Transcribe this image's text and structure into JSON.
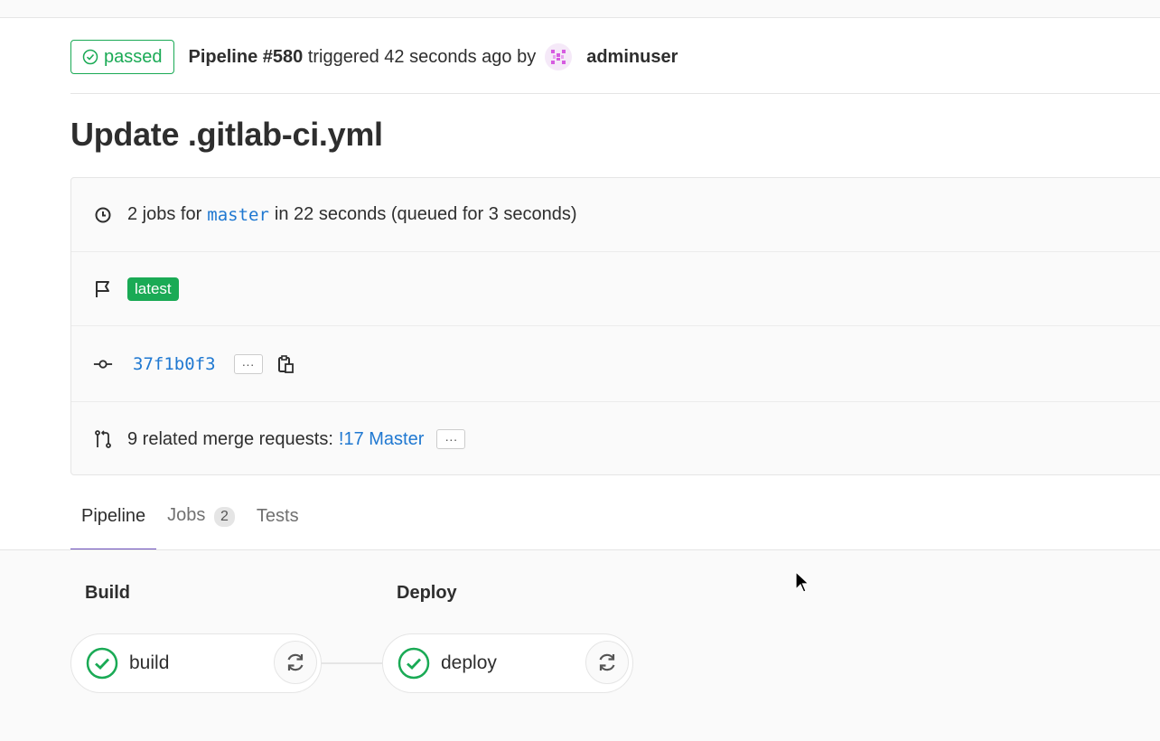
{
  "header": {
    "status_label": "passed",
    "pipeline_label": "Pipeline #580",
    "triggered_text": "triggered 42 seconds ago by",
    "user": "adminuser"
  },
  "title": "Update .gitlab-ci.yml",
  "info": {
    "jobs_prefix": "2 jobs for",
    "branch": "master",
    "jobs_suffix": "in 22 seconds (queued for 3 seconds)",
    "tag": "latest",
    "commit_sha": "37f1b0f3",
    "more_label": "···",
    "mr_prefix": "9 related merge requests:",
    "mr_link": "!17 Master"
  },
  "tabs": [
    {
      "label": "Pipeline"
    },
    {
      "label": "Jobs",
      "count": "2"
    },
    {
      "label": "Tests"
    }
  ],
  "stages": [
    {
      "title": "Build",
      "job": "build"
    },
    {
      "title": "Deploy",
      "job": "deploy"
    }
  ],
  "colors": {
    "success": "#1aaa55",
    "link": "#1f78d1",
    "tab_active": "#6b4fbb"
  }
}
